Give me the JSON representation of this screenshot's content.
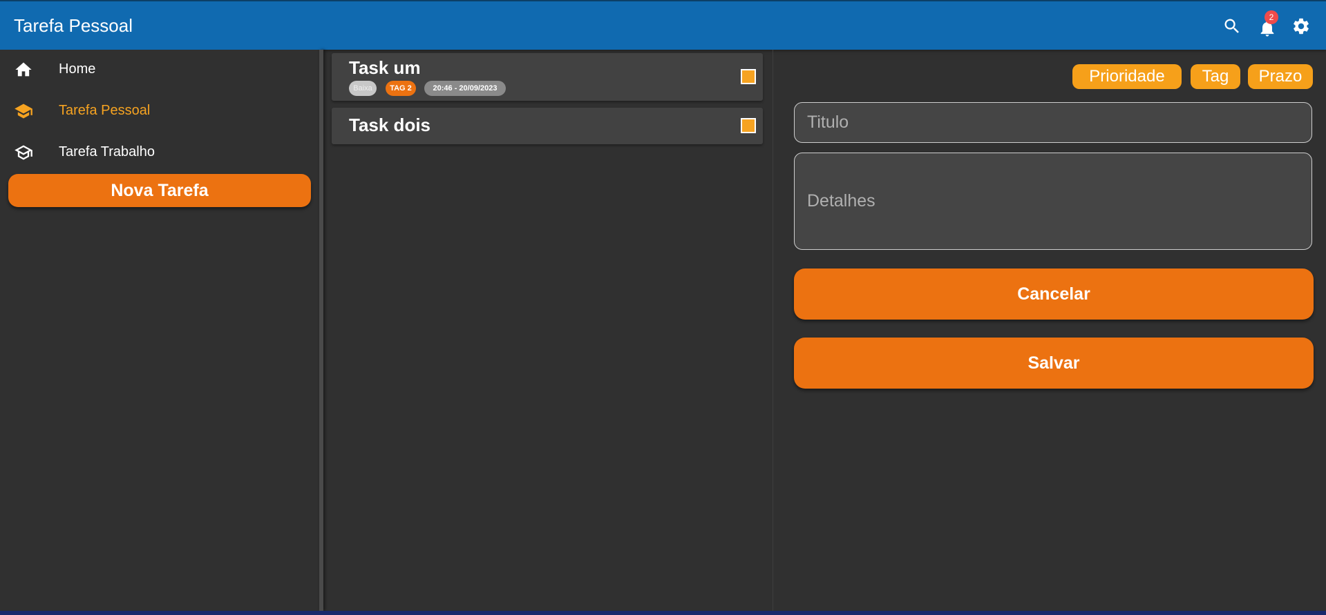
{
  "header": {
    "title": "Tarefa Pessoal",
    "notification_count": "2"
  },
  "sidebar": {
    "items": [
      {
        "label": "Home",
        "icon": "home-icon"
      },
      {
        "label": "Tarefa Pessoal",
        "icon": "school-icon",
        "active": true
      },
      {
        "label": "Tarefa Trabalho",
        "icon": "school-icon"
      }
    ],
    "new_task_label": "Nova Tarefa"
  },
  "tasks": [
    {
      "title": "Task um",
      "priority": "Baixa",
      "tag": "TAG 2",
      "due": "20:46 - 20/09/2023"
    },
    {
      "title": "Task dois"
    }
  ],
  "editor": {
    "filters": [
      "Prioridade",
      "Tag",
      "Prazo"
    ],
    "title_placeholder": "Titulo",
    "details_placeholder": "Detalhes",
    "cancel_label": "Cancelar",
    "save_label": "Salvar"
  },
  "colors": {
    "header": "#106ab0",
    "accent_orange": "#ec7211",
    "accent_yellow": "#f6a321",
    "background": "#303030",
    "card": "#424242"
  }
}
